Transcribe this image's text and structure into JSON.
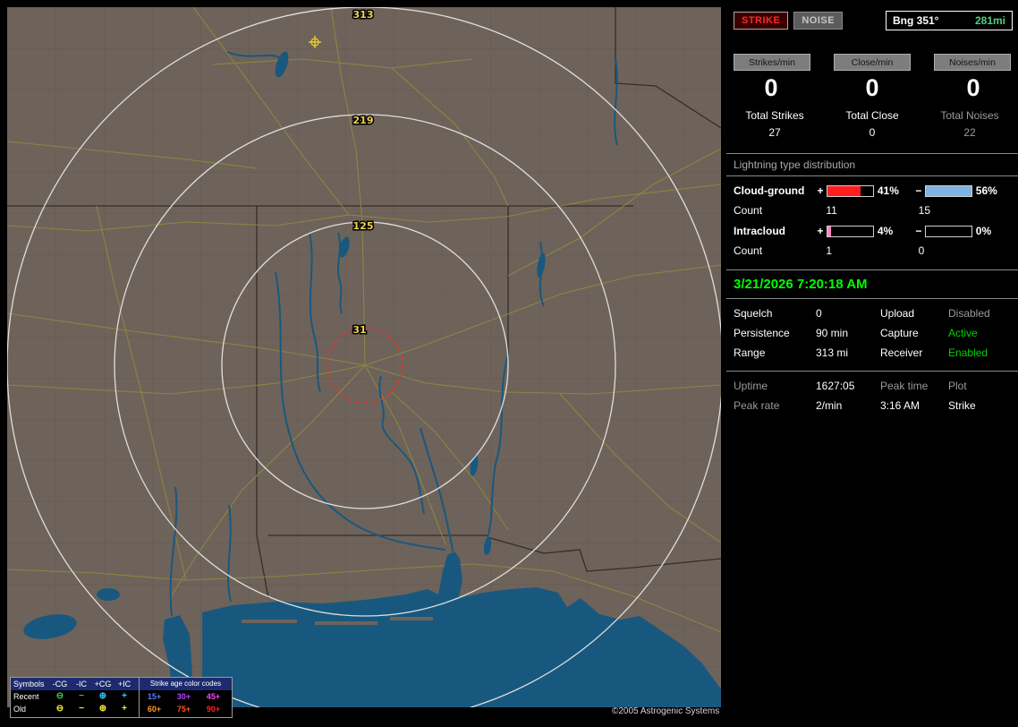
{
  "map": {
    "ring_labels": [
      "313",
      "219",
      "125",
      "31"
    ],
    "copyright": "©2005 Astrogenic Systems",
    "legend": {
      "header_label": "Symbols",
      "columns": [
        "-CG",
        "-IC",
        "+CG",
        "+IC"
      ],
      "age_header": "Strike age color codes",
      "recent_label": "Recent",
      "old_label": "Old",
      "symbols": [
        "⊖",
        "−",
        "⊕",
        "+"
      ],
      "recent_ages": [
        "15+",
        "30+",
        "45+"
      ],
      "old_ages": [
        "60+",
        "75+",
        "90+"
      ]
    }
  },
  "panel": {
    "strike_button": "STRIKE",
    "noise_button": "NOISE",
    "bearing_label": "Bng 351°",
    "bearing_distance": "281mi",
    "rate_chips": [
      "Strikes/min",
      "Close/min",
      "Noises/min"
    ],
    "rate_values": [
      "0",
      "0",
      "0"
    ],
    "totals": [
      {
        "label": "Total Strikes",
        "value": "27"
      },
      {
        "label": "Total Close",
        "value": "0"
      },
      {
        "label": "Total Noises",
        "value": "22"
      }
    ],
    "distribution": {
      "title": "Lightning type distribution",
      "plus_sign": "+",
      "minus_sign": "−",
      "rows": [
        {
          "label": "Cloud-ground",
          "plus_pct": "41%",
          "minus_pct": "56%",
          "plus_val": 41,
          "minus_val": 56,
          "count_label": "Count",
          "plus_count": "11",
          "minus_count": "15"
        },
        {
          "label": "Intracloud",
          "plus_pct": "4%",
          "minus_pct": "0%",
          "plus_val": 4,
          "minus_val": 0,
          "count_label": "Count",
          "plus_count": "1",
          "minus_count": "0"
        }
      ]
    },
    "datetime": "3/21/2026 7:20:18 AM",
    "status_rows": [
      [
        {
          "t": "Squelch"
        },
        {
          "t": "0"
        },
        {
          "t": "Upload"
        },
        {
          "t": "Disabled"
        }
      ],
      [
        {
          "t": "Persistence"
        },
        {
          "t": "90 min"
        },
        {
          "t": "Capture"
        },
        {
          "t": "Active"
        }
      ],
      [
        {
          "t": "Range"
        },
        {
          "t": "313 mi"
        },
        {
          "t": "Receiver"
        },
        {
          "t": "Enabled"
        }
      ]
    ],
    "stats_rows": [
      [
        {
          "t": "Uptime"
        },
        {
          "t": "1627:05"
        },
        {
          "t": "Peak time"
        },
        {
          "t": "Plot"
        }
      ],
      [
        {
          "t": "Peak rate"
        },
        {
          "t": "2/min"
        },
        {
          "t": "3:16 AM"
        },
        {
          "t": "Strike"
        }
      ]
    ]
  },
  "colors": {
    "accent_green": "#00ff00",
    "status_green": "#00d400",
    "distance_green": "#4ecf82",
    "strike_red": "#ff2a2a",
    "bar_plus_cg": "#ff1f1f",
    "bar_minus_cg": "#7fb2e5",
    "bar_plus_ic": "#ff85c2",
    "land": "#6e635a",
    "water": "#19587e"
  }
}
